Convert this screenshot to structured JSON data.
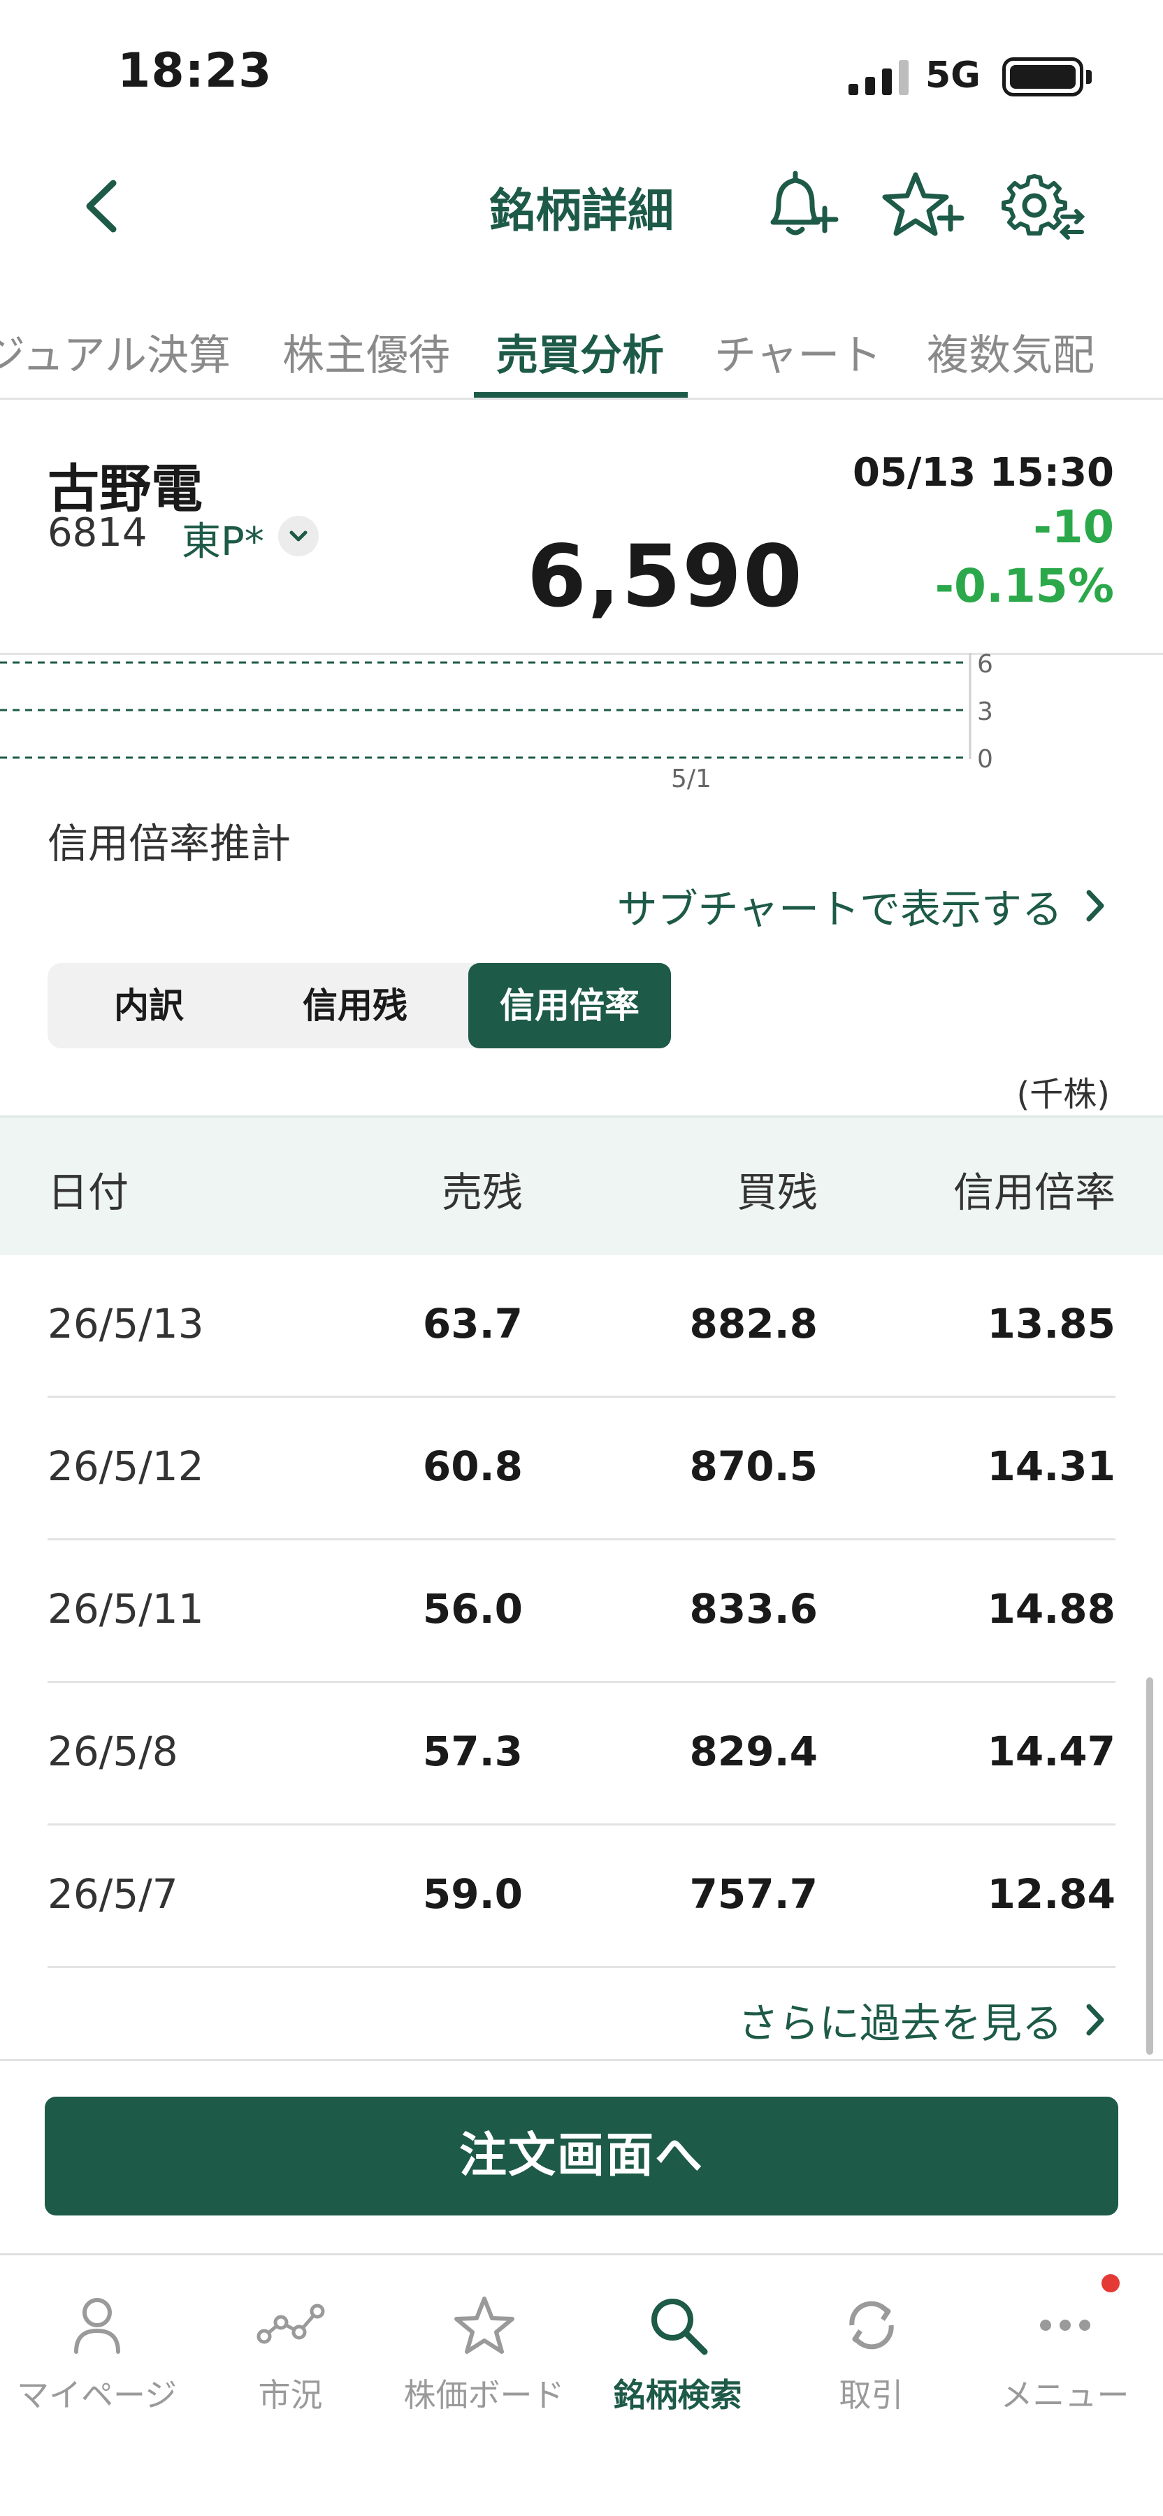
{
  "status_bar": {
    "time": "18:23",
    "network": "5G"
  },
  "header": {
    "title": "銘柄詳細"
  },
  "tabs": [
    {
      "label": "ジュアル決算"
    },
    {
      "label": "株主優待"
    },
    {
      "label": "売買分析"
    },
    {
      "label": "チャート"
    },
    {
      "label": "複数気配"
    }
  ],
  "active_tab": "売買分析",
  "stock": {
    "name": "古野電",
    "code": "6814",
    "market": "東P*",
    "datetime": "05/13 15:30",
    "price": "6,590",
    "change": "-10",
    "change_pct": "-0.15%"
  },
  "mini_chart": {
    "y_ticks": [
      "6",
      "3",
      "0"
    ],
    "x_label": "5/1"
  },
  "section": {
    "title": "信用倍率推計",
    "subchart_link": "サブチャートで表示する"
  },
  "segments": [
    {
      "label": "内訳"
    },
    {
      "label": "信用残"
    },
    {
      "label": "信用倍率"
    }
  ],
  "active_segment": "信用倍率",
  "unit": "(千株)",
  "table": {
    "headers": [
      "日付",
      "売残",
      "買残",
      "信用倍率"
    ],
    "rows": [
      {
        "date": "26/5/13",
        "sell": "63.7",
        "buy": "882.8",
        "ratio": "13.85"
      },
      {
        "date": "26/5/12",
        "sell": "60.8",
        "buy": "870.5",
        "ratio": "14.31"
      },
      {
        "date": "26/5/11",
        "sell": "56.0",
        "buy": "833.6",
        "ratio": "14.88"
      },
      {
        "date": "26/5/8",
        "sell": "57.3",
        "buy": "829.4",
        "ratio": "14.47"
      },
      {
        "date": "26/5/7",
        "sell": "59.0",
        "buy": "757.7",
        "ratio": "12.84"
      }
    ]
  },
  "more_link": "さらに過去を見る",
  "order_button": "注文画面へ",
  "bottom_nav": [
    {
      "label": "マイページ",
      "icon": "person-icon"
    },
    {
      "label": "市況",
      "icon": "market-graph-icon"
    },
    {
      "label": "株価ボード",
      "icon": "star-icon"
    },
    {
      "label": "銘柄検索",
      "icon": "search-icon"
    },
    {
      "label": "取引",
      "icon": "refresh-icon"
    },
    {
      "label": "メニュー",
      "icon": "more-dots-icon"
    }
  ],
  "active_nav": "銘柄検索",
  "colors": {
    "brand_green": "#1d5a47",
    "change_green": "#2aa84a",
    "notification_red": "#e53935"
  }
}
